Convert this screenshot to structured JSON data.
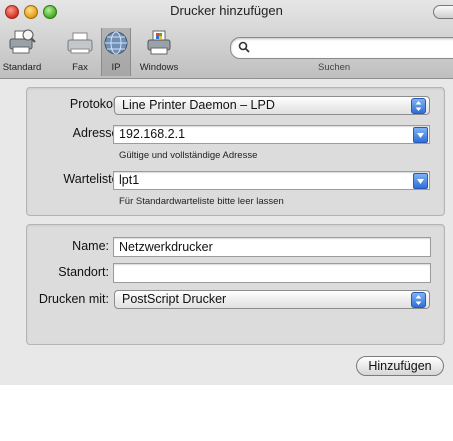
{
  "window": {
    "title": "Drucker hinzufügen"
  },
  "toolbar": {
    "items": [
      {
        "label": "Standard",
        "icon": "default-printer-icon"
      },
      {
        "label": "Fax",
        "icon": "fax-icon"
      },
      {
        "label": "IP",
        "icon": "ip-globe-icon",
        "selected": true
      },
      {
        "label": "Windows",
        "icon": "windows-printer-icon"
      }
    ],
    "search_label": "Suchen",
    "search_value": ""
  },
  "form1": {
    "protocol_label": "Protokoll:",
    "protocol_value": "Line Printer Daemon – LPD",
    "address_label": "Adresse:",
    "address_value": "192.168.2.1",
    "address_hint": "Gültige und vollständige Adresse",
    "queue_label": "Warteliste:",
    "queue_value": "lpt1",
    "queue_hint": "Für Standardwarteliste bitte leer lassen"
  },
  "form2": {
    "name_label": "Name:",
    "name_value": "Netzwerkdrucker",
    "location_label": "Standort:",
    "location_value": "",
    "print_with_label": "Drucken mit:",
    "print_with_value": "PostScript Drucker"
  },
  "actions": {
    "add_label": "Hinzufügen"
  },
  "colors": {
    "accent_blue": "#2f6fd8",
    "window_bg": "#e8e8e8",
    "group_bg": "#dcdcdc"
  }
}
